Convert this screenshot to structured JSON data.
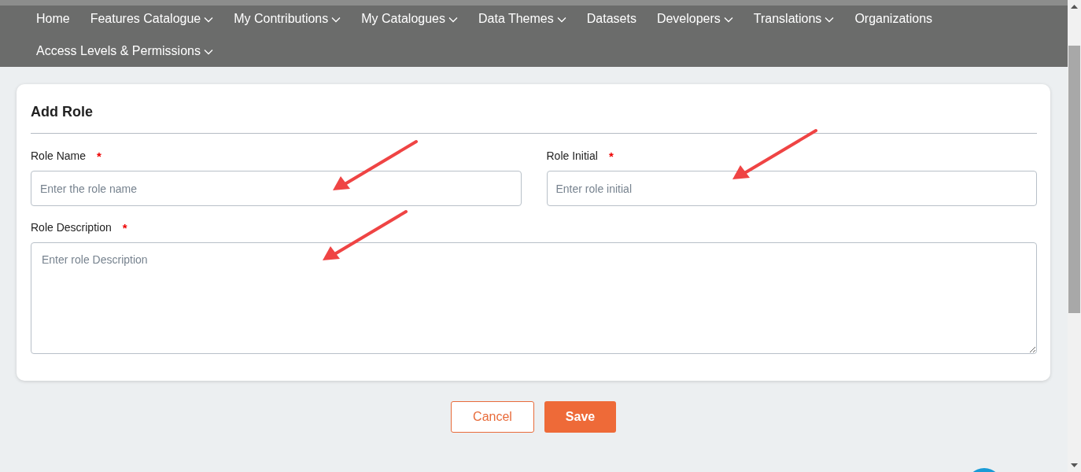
{
  "nav": {
    "items": [
      {
        "label": "Home",
        "dropdown": false
      },
      {
        "label": "Features Catalogue",
        "dropdown": true
      },
      {
        "label": "My Contributions",
        "dropdown": true
      },
      {
        "label": "My Catalogues",
        "dropdown": true
      },
      {
        "label": "Data Themes",
        "dropdown": true
      },
      {
        "label": "Datasets",
        "dropdown": false
      },
      {
        "label": "Developers",
        "dropdown": true
      },
      {
        "label": "Translations",
        "dropdown": true
      },
      {
        "label": "Organizations",
        "dropdown": false
      },
      {
        "label": "Access Levels & Permissions",
        "dropdown": true
      }
    ]
  },
  "form": {
    "title": "Add Role",
    "fields": [
      {
        "kind": "input",
        "label": "Role Name",
        "required_mark": "*",
        "placeholder": "Enter the role name",
        "annotated": true
      },
      {
        "kind": "input",
        "label": "Role Initial",
        "required_mark": "*",
        "placeholder": "Enter role initial",
        "annotated": true
      },
      {
        "kind": "textarea",
        "label": "Role Description",
        "required_mark": "*",
        "placeholder": "Enter role Description",
        "annotated": true
      }
    ]
  },
  "actions": [
    {
      "kind": "secondary",
      "label": "Cancel"
    },
    {
      "kind": "primary",
      "label": "Save"
    }
  ]
}
